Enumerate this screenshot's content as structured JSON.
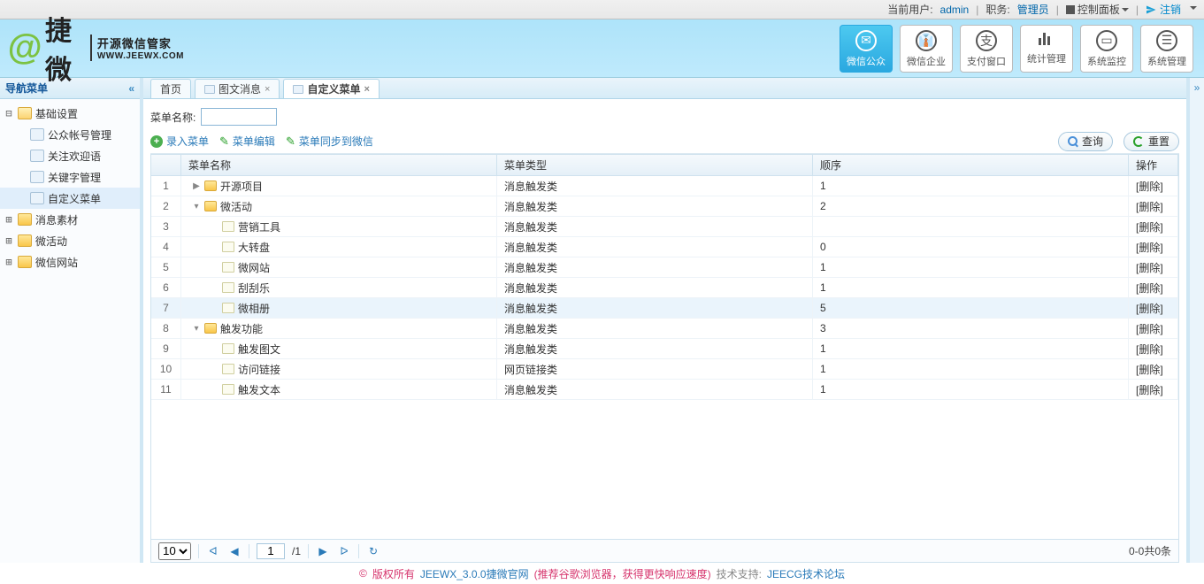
{
  "topbar": {
    "user_label": "当前用户:",
    "user": "admin",
    "role_label": "职务:",
    "role": "管理员",
    "panel": "控制面板",
    "logout": "注销"
  },
  "logo": {
    "brand": "捷微",
    "sub_zh": "开源微信管家",
    "sub_en": "WWW.JEEWX.COM"
  },
  "nav": [
    {
      "label": "微信公众",
      "icon": "wechat-icon",
      "active": true
    },
    {
      "label": "微信企业",
      "icon": "enterprise-icon",
      "active": false
    },
    {
      "label": "支付窗口",
      "icon": "pay-icon",
      "active": false
    },
    {
      "label": "统计管理",
      "icon": "stats-icon",
      "active": false
    },
    {
      "label": "系统监控",
      "icon": "monitor-icon",
      "active": false
    },
    {
      "label": "系统管理",
      "icon": "settings-icon",
      "active": false
    }
  ],
  "sidebar": {
    "title": "导航菜单",
    "items": [
      {
        "label": "基础设置",
        "level": 0,
        "open": true,
        "folder": true,
        "toggle": "−"
      },
      {
        "label": "公众帐号管理",
        "level": 1,
        "folder": false
      },
      {
        "label": "关注欢迎语",
        "level": 1,
        "folder": false
      },
      {
        "label": "关键字管理",
        "level": 1,
        "folder": false
      },
      {
        "label": "自定义菜单",
        "level": 1,
        "folder": false,
        "selected": true
      },
      {
        "label": "消息素材",
        "level": 0,
        "open": false,
        "folder": true,
        "toggle": "+"
      },
      {
        "label": "微活动",
        "level": 0,
        "open": false,
        "folder": true,
        "toggle": "+"
      },
      {
        "label": "微信网站",
        "level": 0,
        "open": false,
        "folder": true,
        "toggle": "+"
      }
    ]
  },
  "tabs": [
    {
      "label": "首页",
      "closable": false
    },
    {
      "label": "图文消息",
      "closable": true
    },
    {
      "label": "自定义菜单",
      "closable": true,
      "active": true
    }
  ],
  "form": {
    "name_label": "菜单名称:",
    "name_value": ""
  },
  "toolbar": {
    "add": "录入菜单",
    "edit": "菜单编辑",
    "sync": "菜单同步到微信",
    "search": "查询",
    "reset": "重置"
  },
  "grid": {
    "columns": {
      "name": "菜单名称",
      "type": "菜单类型",
      "order": "顺序",
      "op": "操作"
    },
    "delete_label": "[删除]",
    "rows": [
      {
        "rn": 1,
        "indent": 0,
        "toggle": "▶",
        "folder": true,
        "name": "开源项目",
        "type": "消息触发类",
        "order": "1"
      },
      {
        "rn": 2,
        "indent": 0,
        "toggle": "▾",
        "folder": true,
        "name": "微活动",
        "type": "消息触发类",
        "order": "2"
      },
      {
        "rn": 3,
        "indent": 1,
        "folder": false,
        "name": "营销工具",
        "type": "消息触发类",
        "order": ""
      },
      {
        "rn": 4,
        "indent": 1,
        "folder": false,
        "name": "大转盘",
        "type": "消息触发类",
        "order": "0"
      },
      {
        "rn": 5,
        "indent": 1,
        "folder": false,
        "name": "微网站",
        "type": "消息触发类",
        "order": "1"
      },
      {
        "rn": 6,
        "indent": 1,
        "folder": false,
        "name": "刮刮乐",
        "type": "消息触发类",
        "order": "1"
      },
      {
        "rn": 7,
        "indent": 1,
        "folder": false,
        "name": "微相册",
        "type": "消息触发类",
        "order": "5",
        "hl": true
      },
      {
        "rn": 8,
        "indent": 0,
        "toggle": "▾",
        "folder": true,
        "name": "触发功能",
        "type": "消息触发类",
        "order": "3"
      },
      {
        "rn": 9,
        "indent": 1,
        "folder": false,
        "name": "触发图文",
        "type": "消息触发类",
        "order": "1"
      },
      {
        "rn": 10,
        "indent": 1,
        "folder": false,
        "name": "访问链接",
        "type": "网页链接类",
        "order": "1"
      },
      {
        "rn": 11,
        "indent": 1,
        "folder": false,
        "name": "触发文本",
        "type": "消息触发类",
        "order": "1"
      }
    ]
  },
  "pager": {
    "page_size": "10",
    "page": "1",
    "pages": "/1",
    "info": "0-0共0条"
  },
  "footer": {
    "copyright": "版权所有",
    "product": "JEEWX_3.0.0捷微官网",
    "browser_tip": "(推荐谷歌浏览器，获得更快响应速度)",
    "support_label": "技术支持:",
    "support_link": "JEECG技术论坛"
  }
}
